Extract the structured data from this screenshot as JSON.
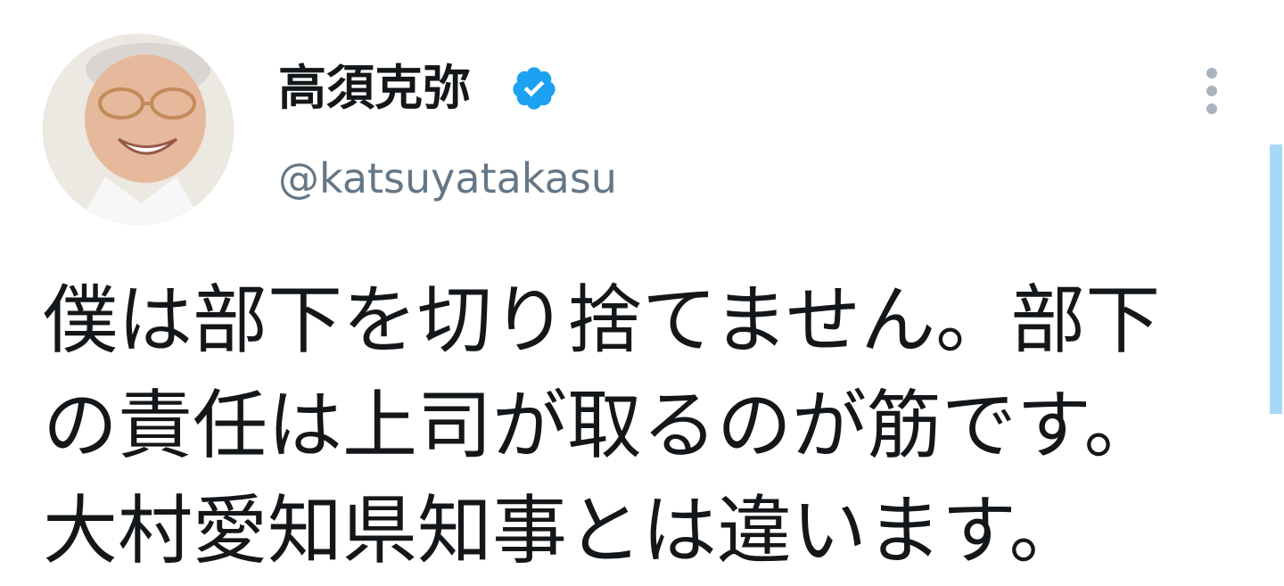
{
  "author": {
    "display_name": "高須克弥",
    "handle": "@katsuyatakasu",
    "verified": true,
    "avatar_icon": "profile-photo"
  },
  "tweet": {
    "lines": [
      "僕は部下を切り捨てません。部下",
      "の責任は上司が取るのが筋です。",
      "大村愛知県知事とは違います。"
    ]
  },
  "icons": {
    "verified": "verified-badge-icon",
    "more": "more-vertical-icon"
  },
  "colors": {
    "verified_blue": "#1da1f2",
    "handle_gray": "#657786",
    "text": "#14171a",
    "scroll_accent": "#a8d8f8"
  }
}
